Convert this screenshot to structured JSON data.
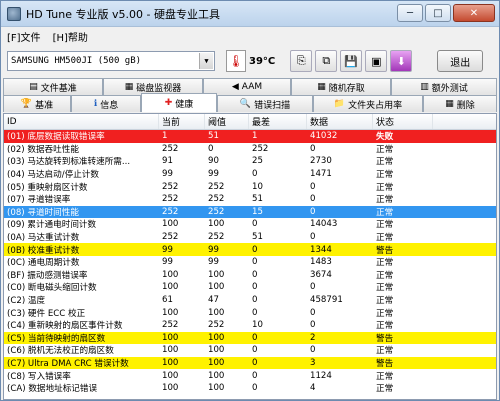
{
  "window": {
    "title": "HD Tune 专业版 v5.00 - 硬盘专业工具",
    "min": "─",
    "max": "□",
    "close": "✕"
  },
  "menu": [
    "[F]文件",
    "[H]帮助"
  ],
  "toolbar": {
    "drive": "SAMSUNG HM500JI (500 gB)",
    "temperature": "39°C",
    "exit": "退出"
  },
  "tabs_top": [
    "文件基准",
    "磁盘监视器",
    "AAM",
    "随机存取",
    "额外测试"
  ],
  "tabs_bottom": [
    "基准",
    "信息",
    "健康",
    "错误扫描",
    "文件夹占用率",
    "删除"
  ],
  "active_tab": "健康",
  "table": {
    "headers": [
      "ID",
      "当前",
      "阈值",
      "最差",
      "数据",
      "状态"
    ],
    "rows": [
      {
        "id": "(01) 底层数据读取错误率",
        "cur": "1",
        "thr": "51",
        "worst": "1",
        "data": "41032",
        "status": "失败",
        "hl": "red"
      },
      {
        "id": "(02) 数据吞吐性能",
        "cur": "252",
        "thr": "0",
        "worst": "252",
        "data": "0",
        "status": "正常",
        "hl": ""
      },
      {
        "id": "(03) 马达旋转到标准转速所需...",
        "cur": "91",
        "thr": "90",
        "worst": "25",
        "data": "2730",
        "status": "正常",
        "hl": ""
      },
      {
        "id": "(04) 马达启动/停止计数",
        "cur": "99",
        "thr": "99",
        "worst": "0",
        "data": "1471",
        "status": "正常",
        "hl": ""
      },
      {
        "id": "(05) 重映射扇区计数",
        "cur": "252",
        "thr": "252",
        "worst": "10",
        "data": "0",
        "status": "正常",
        "hl": ""
      },
      {
        "id": "(07) 寻道错误率",
        "cur": "252",
        "thr": "252",
        "worst": "51",
        "data": "0",
        "status": "正常",
        "hl": ""
      },
      {
        "id": "(08) 寻道时间性能",
        "cur": "252",
        "thr": "252",
        "worst": "15",
        "data": "0",
        "status": "正常",
        "hl": "blue"
      },
      {
        "id": "(09) 累计通电时间计数",
        "cur": "100",
        "thr": "100",
        "worst": "0",
        "data": "14043",
        "status": "正常",
        "hl": ""
      },
      {
        "id": "(0A) 马达重试计数",
        "cur": "252",
        "thr": "252",
        "worst": "51",
        "data": "0",
        "status": "正常",
        "hl": ""
      },
      {
        "id": "(0B) 校准重试计数",
        "cur": "99",
        "thr": "99",
        "worst": "0",
        "data": "1344",
        "status": "警告",
        "hl": "yellow"
      },
      {
        "id": "(0C) 通电周期计数",
        "cur": "99",
        "thr": "99",
        "worst": "0",
        "data": "1483",
        "status": "正常",
        "hl": ""
      },
      {
        "id": "(BF) 振动感测错误率",
        "cur": "100",
        "thr": "100",
        "worst": "0",
        "data": "3674",
        "status": "正常",
        "hl": ""
      },
      {
        "id": "(C0) 断电磁头缩回计数",
        "cur": "100",
        "thr": "100",
        "worst": "0",
        "data": "0",
        "status": "正常",
        "hl": ""
      },
      {
        "id": "(C2) 温度",
        "cur": "61",
        "thr": "47",
        "worst": "0",
        "data": "458791",
        "status": "正常",
        "hl": ""
      },
      {
        "id": "(C3) 硬件 ECC 校正",
        "cur": "100",
        "thr": "100",
        "worst": "0",
        "data": "0",
        "status": "正常",
        "hl": ""
      },
      {
        "id": "(C4) 重新映射的扇区事件计数",
        "cur": "252",
        "thr": "252",
        "worst": "10",
        "data": "0",
        "status": "正常",
        "hl": ""
      },
      {
        "id": "(C5) 当前待映射的扇区数",
        "cur": "100",
        "thr": "100",
        "worst": "0",
        "data": "2",
        "status": "警告",
        "hl": "yellow"
      },
      {
        "id": "(C6) 脱机无法校正的扇区数",
        "cur": "100",
        "thr": "100",
        "worst": "0",
        "data": "0",
        "status": "正常",
        "hl": ""
      },
      {
        "id": "(C7) Ultra DMA CRC 错误计数",
        "cur": "100",
        "thr": "100",
        "worst": "0",
        "data": "3",
        "status": "警告",
        "hl": "yellow"
      },
      {
        "id": "(C8) 写入错误率",
        "cur": "100",
        "thr": "100",
        "worst": "0",
        "data": "1124",
        "status": "正常",
        "hl": ""
      },
      {
        "id": "(CA) 数据地址标记错误",
        "cur": "100",
        "thr": "100",
        "worst": "0",
        "data": "4",
        "status": "正常",
        "hl": ""
      }
    ]
  },
  "colors": {
    "fail": "#f02020",
    "warn": "#fff200",
    "selected": "#3296f0"
  },
  "icons": [
    "drive-icon",
    "thermometer-icon",
    "copy-icon",
    "copy-all-icon",
    "save-icon",
    "screenshot-icon",
    "download-icon"
  ]
}
